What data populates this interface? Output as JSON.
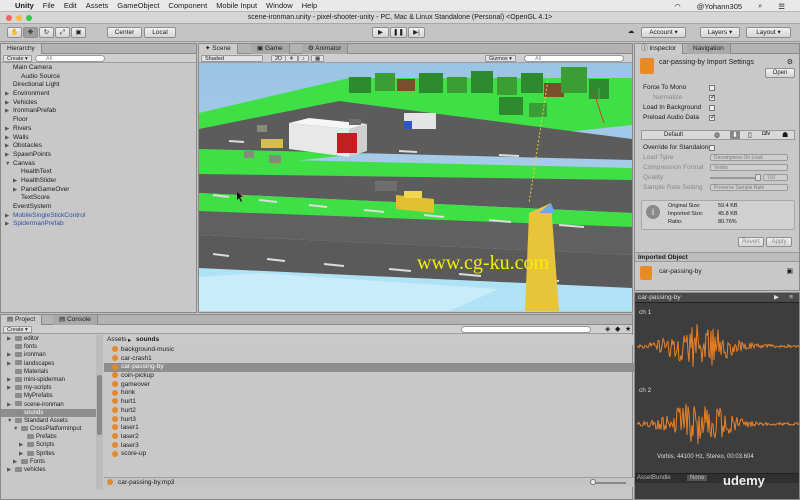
{
  "menubar": {
    "app": "Unity",
    "items": [
      "File",
      "Edit",
      "Assets",
      "GameObject",
      "Component",
      "Mobile Input",
      "Window",
      "Help"
    ],
    "user": "@Yohann305"
  },
  "title": "scene-ironman.unity - pixel-shooter-unity - PC, Mac & Linux Standalone (Personal) <OpenGL 4.1>",
  "toolbar": {
    "center": "Center",
    "local": "Local",
    "account": "Account",
    "layers": "Layers",
    "layout": "Layout"
  },
  "hierarchy": {
    "tab": "Hierarchy",
    "create": "Create",
    "search_placeholder": "All",
    "items": [
      {
        "label": "Main Camera",
        "indent": 0,
        "caret": "",
        "blue": false
      },
      {
        "label": "Audio Source",
        "indent": 1,
        "caret": "",
        "blue": false
      },
      {
        "label": "Directional Light",
        "indent": 0,
        "caret": "",
        "blue": false
      },
      {
        "label": "Environment",
        "indent": 0,
        "caret": "▶",
        "blue": false
      },
      {
        "label": "Vehicles",
        "indent": 0,
        "caret": "▶",
        "blue": false
      },
      {
        "label": "IronmanPrefab",
        "indent": 0,
        "caret": "▶",
        "blue": false
      },
      {
        "label": "Floor",
        "indent": 0,
        "caret": "",
        "blue": false
      },
      {
        "label": "Rivers",
        "indent": 0,
        "caret": "▶",
        "blue": false
      },
      {
        "label": "Walls",
        "indent": 0,
        "caret": "▶",
        "blue": false
      },
      {
        "label": "Obstacles",
        "indent": 0,
        "caret": "▶",
        "blue": false
      },
      {
        "label": "SpawnPoints",
        "indent": 0,
        "caret": "▶",
        "blue": false
      },
      {
        "label": "Canvas",
        "indent": 0,
        "caret": "▼",
        "blue": false
      },
      {
        "label": "HealthText",
        "indent": 1,
        "caret": "",
        "blue": false
      },
      {
        "label": "HealthSlider",
        "indent": 1,
        "caret": "▶",
        "blue": false
      },
      {
        "label": "PanelGameOver",
        "indent": 1,
        "caret": "▶",
        "blue": false
      },
      {
        "label": "TextScore",
        "indent": 1,
        "caret": "",
        "blue": false
      },
      {
        "label": "EventSystem",
        "indent": 0,
        "caret": "",
        "blue": false
      },
      {
        "label": "MobileSingleStickControl",
        "indent": 0,
        "caret": "▶",
        "blue": true
      },
      {
        "label": "SpidermanPrefab",
        "indent": 0,
        "caret": "▶",
        "blue": true
      }
    ]
  },
  "scene": {
    "tabs": [
      "Scene",
      "Game",
      "Animator"
    ],
    "shading": "Shaded",
    "mode2d": "2D",
    "gizmos": "Gizmos",
    "search_placeholder": "All",
    "watermark": "www.cg-ku.com"
  },
  "inspector": {
    "tabs": [
      "Inspector",
      "Navigation"
    ],
    "asset_title": "car-passing-by Import Settings",
    "open": "Open",
    "force_mono": "Force To Mono",
    "normalize": "Normalize",
    "load_background": "Load In Background",
    "preload": "Preload Audio Data",
    "default_tab": "Default",
    "override": "Override for Standalone",
    "load_type": "Load Type",
    "load_type_value": "Decompress On Load",
    "compression": "Compression Format",
    "compression_value": "Vorbis",
    "quality": "Quality",
    "quality_value": "100",
    "sample_rate": "Sample Rate Setting",
    "sample_rate_value": "Preserve Sample Rate",
    "original_size_label": "Original Size:",
    "original_size": "59.4 KB",
    "imported_size_label": "Imported Size:",
    "imported_size": "45.8 KB",
    "ratio_label": "Ratio:",
    "ratio": "80.76%",
    "revert": "Revert",
    "apply": "Apply",
    "imported_object": "Imported Object",
    "object_name": "car-passing-by"
  },
  "preview": {
    "title": "car-passing-by",
    "ch1": "ch 1",
    "ch2": "ch 2",
    "info": "Vorbis, 44100 Hz, Stereo, 00:03.604",
    "assetbundle": "AssetBundle",
    "none": "None",
    "brand": "udemy"
  },
  "project": {
    "tabs": [
      "Project",
      "Console"
    ],
    "create": "Create",
    "breadcrumb_root": "Assets",
    "breadcrumb_folder": "sounds",
    "tree": [
      {
        "label": "editor",
        "indent": 1,
        "caret": "▶",
        "selected": false
      },
      {
        "label": "fonts",
        "indent": 1,
        "caret": "",
        "selected": false
      },
      {
        "label": "ironman",
        "indent": 1,
        "caret": "▶",
        "selected": false
      },
      {
        "label": "landscapes",
        "indent": 1,
        "caret": "▶",
        "selected": false
      },
      {
        "label": "Materials",
        "indent": 1,
        "caret": "",
        "selected": false
      },
      {
        "label": "mini-spiderman",
        "indent": 1,
        "caret": "▶",
        "selected": false
      },
      {
        "label": "my-scripts",
        "indent": 1,
        "caret": "▶",
        "selected": false
      },
      {
        "label": "MyPrefabs",
        "indent": 1,
        "caret": "",
        "selected": false
      },
      {
        "label": "scene-ironman",
        "indent": 1,
        "caret": "▶",
        "selected": false
      },
      {
        "label": "sounds",
        "indent": 1,
        "caret": "",
        "selected": true
      },
      {
        "label": "Standard Assets",
        "indent": 1,
        "caret": "▼",
        "selected": false
      },
      {
        "label": "CrossPlatformInput",
        "indent": 2,
        "caret": "▼",
        "selected": false
      },
      {
        "label": "Prefabs",
        "indent": 3,
        "caret": "",
        "selected": false
      },
      {
        "label": "Scripts",
        "indent": 3,
        "caret": "▶",
        "selected": false
      },
      {
        "label": "Sprites",
        "indent": 3,
        "caret": "▶",
        "selected": false
      },
      {
        "label": "Fonts",
        "indent": 2,
        "caret": "▶",
        "selected": false
      },
      {
        "label": "vehicles",
        "indent": 1,
        "caret": "▶",
        "selected": false
      }
    ],
    "files": [
      "background-music",
      "car-crash1",
      "car-passing-by",
      "coin-pickup",
      "gameover",
      "honk",
      "hurt1",
      "hurt2",
      "hurt3",
      "laser1",
      "laser2",
      "laser3",
      "score-up"
    ],
    "selected_file": "car-passing-by",
    "status": "car-passing-by.mp3"
  }
}
